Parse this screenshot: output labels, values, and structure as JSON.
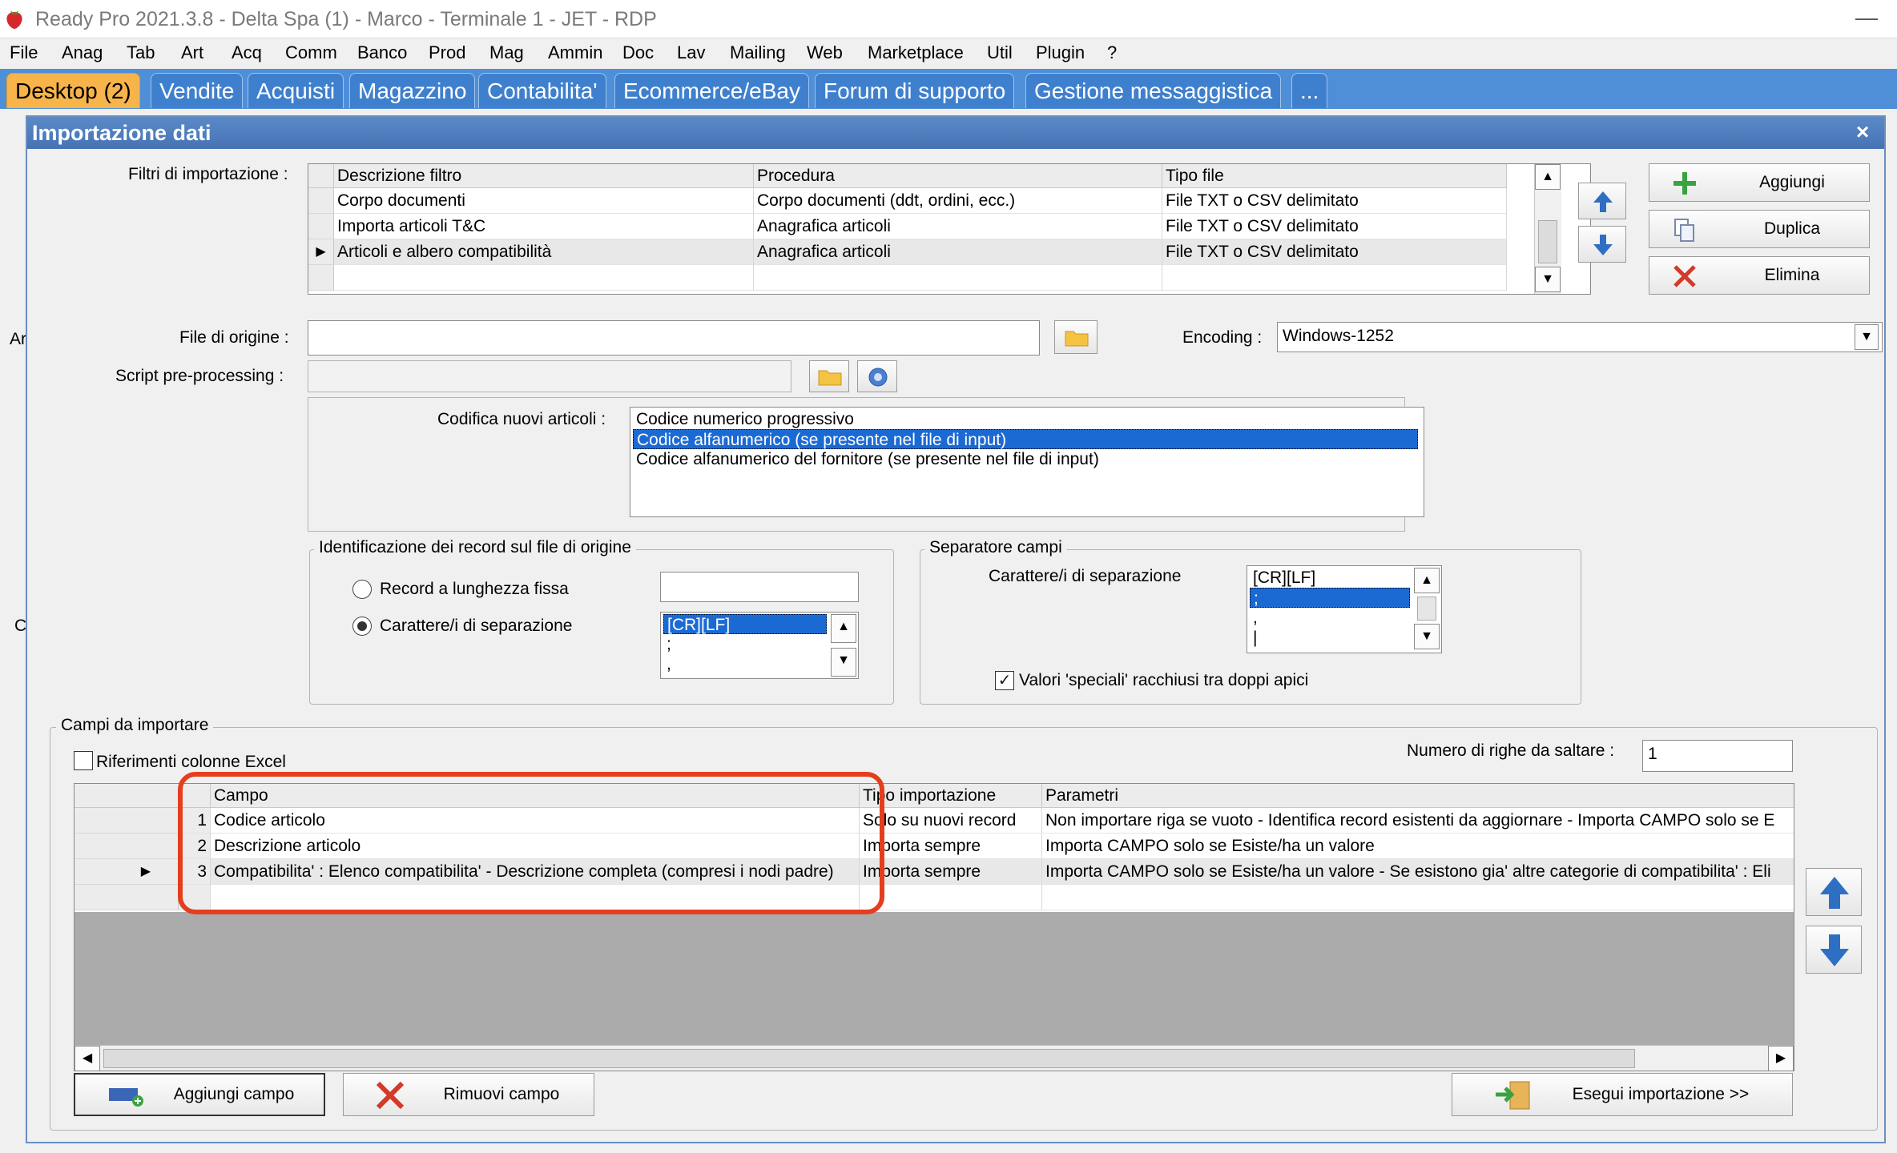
{
  "window": {
    "title": "Ready Pro 2021.3.8 - Delta Spa (1) - Marco - Terminale 1 - JET - RDP",
    "minimize": "—"
  },
  "menu": [
    "File",
    "Anag",
    "Tab",
    "Art",
    "Acq",
    "Comm",
    "Banco",
    "Prod",
    "Mag",
    "Ammin",
    "Doc",
    "Lav",
    "Mailing",
    "Web",
    "Marketplace",
    "Util",
    "Plugin",
    "?"
  ],
  "tabs": [
    "Desktop (2)",
    "Vendite",
    "Acquisti",
    "Magazzino",
    "Contabilita'",
    "Ecommerce/eBay",
    "Forum di supporto",
    "Gestione messaggistica",
    "..."
  ],
  "dialog": {
    "title": "Importazione dati",
    "close": "×",
    "filters": {
      "label": "Filtri di importazione :",
      "headers": [
        "Descrizione filtro",
        "Procedura",
        "Tipo file"
      ],
      "rows": [
        [
          "Corpo documenti",
          "Corpo documenti (ddt, ordini, ecc.)",
          "File TXT o CSV delimitato"
        ],
        [
          "Importa articoli T&C",
          "Anagrafica articoli",
          "File TXT o CSV delimitato"
        ],
        [
          "Articoli e albero compatibilità",
          "Anagrafica articoli",
          "File TXT o CSV delimitato"
        ]
      ],
      "current_marker": "▶"
    },
    "buttons": {
      "add": "Aggiungi",
      "duplicate": "Duplica",
      "delete": "Elimina"
    },
    "source_file": {
      "label": "File di origine :",
      "value": ""
    },
    "encoding": {
      "label": "Encoding :",
      "value": "Windows-1252"
    },
    "script": {
      "label": "Script pre-processing :",
      "value": ""
    },
    "new_codes": {
      "label": "Codifica nuovi articoli :",
      "options": [
        "Codice numerico progressivo",
        "Codice alfanumerico (se presente nel file di input)",
        "Codice alfanumerico del fornitore (se presente nel file di input)"
      ]
    },
    "record_id": {
      "title": "Identificazione dei record sul file di origine",
      "fixed_label": "Record a lunghezza fissa",
      "sep_label": "Carattere/i di separazione",
      "fixed_value": "",
      "sep_options": [
        "[CR][LF]",
        ";",
        ","
      ]
    },
    "field_sep": {
      "title": "Separatore campi",
      "label": "Carattere/i di separazione",
      "options": [
        "[CR][LF]",
        ";",
        ",",
        "|"
      ],
      "quotes_label": "Valori 'speciali' racchiusi tra doppi apici",
      "check_mark": "✓"
    },
    "fields": {
      "title": "Campi da importare",
      "excel_label": "Riferimenti colonne Excel",
      "skip_label": "Numero di righe da saltare :",
      "skip_value": "1",
      "headers": [
        "Campo",
        "Tipo importazione",
        "Parametri"
      ],
      "rows": [
        {
          "num": "1",
          "campo": "Codice articolo",
          "tipo": "Solo su nuovi record",
          "param": "Non importare riga se vuoto - Identifica record esistenti da aggiornare - Importa CAMPO solo se E"
        },
        {
          "num": "2",
          "campo": "Descrizione articolo",
          "tipo": "Importa sempre",
          "param": "Importa CAMPO solo se Esiste/ha un valore"
        },
        {
          "num": "3",
          "campo": "Compatibilita' : Elenco compatibilita' - Descrizione completa (compresi i nodi padre)",
          "tipo": "Importa sempre",
          "param": "Importa CAMPO solo se Esiste/ha un valore  - Se esistono gia' altre categorie di compatibilita' : Eli"
        }
      ],
      "current_marker": "▶"
    },
    "bottom": {
      "add_field": "Aggiungi campo",
      "remove_field": "Rimuovi campo",
      "run": "Esegui importazione >>"
    },
    "side_letters": [
      "Ar",
      "C"
    ]
  },
  "colors": {
    "tabbar": "#4f8fd8",
    "active_tab": "#f7b44a",
    "highlight": "#e53e1e",
    "selection": "#1b6ad4"
  }
}
